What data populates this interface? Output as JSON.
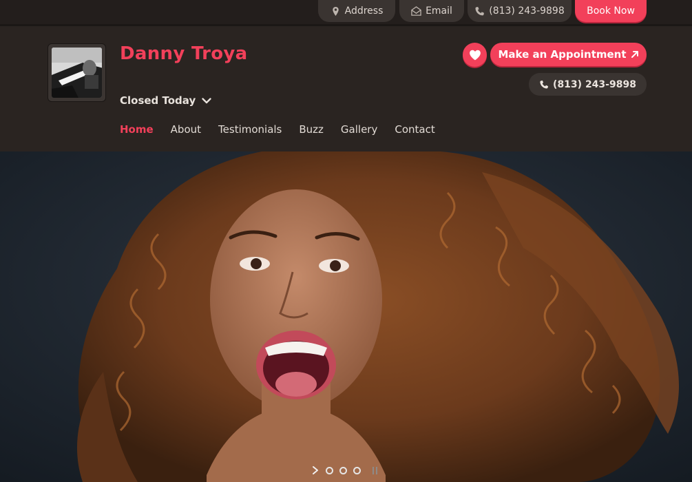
{
  "topbar": {
    "address_label": "Address",
    "email_label": "Email",
    "phone_label": "(813) 243-9898",
    "book_label": "Book Now"
  },
  "business": {
    "name": "Danny Troya",
    "hours_status": "Closed Today"
  },
  "actions": {
    "appointment_label": "Make an Appointment",
    "phone_label": "(813) 243-9898"
  },
  "nav": {
    "items": [
      {
        "label": "Home",
        "active": true
      },
      {
        "label": "About"
      },
      {
        "label": "Testimonials"
      },
      {
        "label": "Buzz"
      },
      {
        "label": "Gallery"
      },
      {
        "label": "Contact"
      }
    ]
  },
  "slider": {
    "slide_count": 3,
    "icons": [
      "chevron-right-icon",
      "pause-icon"
    ]
  },
  "colors": {
    "accent": "#f2405a",
    "header_bg": "#2a2421",
    "pill_bg": "#3a3431"
  }
}
